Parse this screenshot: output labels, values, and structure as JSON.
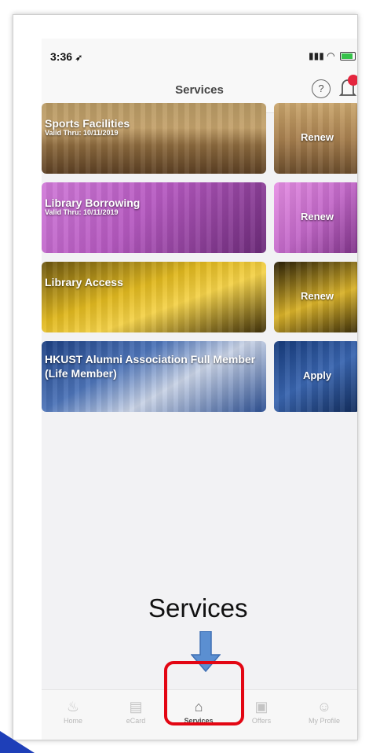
{
  "status_bar": {
    "time": "3:36",
    "location_icon": "location-arrow-icon",
    "signal_icon": "signal-icon",
    "wifi_icon": "wifi-icon",
    "battery_icon": "battery-icon"
  },
  "header": {
    "title": "Services",
    "help_icon": "question-circle-icon",
    "help_glyph": "?",
    "bell_icon": "bell-icon"
  },
  "cards": [
    {
      "title": "Sports Facilities",
      "valid": "Valid Thru: 10/11/2019",
      "action": "Renew"
    },
    {
      "title": "Library Borrowing",
      "valid": "Valid Thru: 10/11/2019",
      "action": "Renew"
    },
    {
      "title": "Library Access",
      "valid": "",
      "action": "Renew"
    },
    {
      "title": "HKUST Alumni Association Full Member (Life Member)",
      "valid": "",
      "action": "Apply"
    }
  ],
  "annotation": {
    "label": "Services",
    "arrow_icon": "down-arrow-icon",
    "arrow_color": "#5b8fd1",
    "highlight_color": "#e30613"
  },
  "tabs": [
    {
      "label": "Home",
      "icon": "home-flame-icon",
      "active": false
    },
    {
      "label": "eCard",
      "icon": "card-icon",
      "active": false
    },
    {
      "label": "Services",
      "icon": "services-icon",
      "active": true
    },
    {
      "label": "Offers",
      "icon": "gift-icon",
      "active": false
    },
    {
      "label": "My Profile",
      "icon": "person-icon",
      "active": false
    }
  ]
}
